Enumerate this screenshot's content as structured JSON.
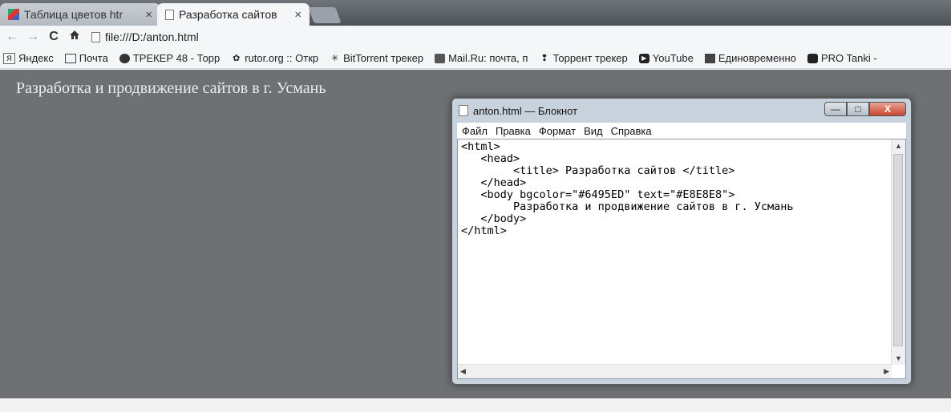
{
  "browser": {
    "tabs": [
      {
        "label": "Таблица цветов htr",
        "close": "×",
        "active": false
      },
      {
        "label": "Разработка сайтов",
        "close": "×",
        "active": true
      }
    ],
    "nav": {
      "back": "←",
      "forward": "→",
      "reload": "C",
      "home": "🏠"
    },
    "address": "file:///D:/anton.html",
    "bookmarks": [
      {
        "label": "Яндекс",
        "icon": "yandex-icon"
      },
      {
        "label": "Почта",
        "icon": "folder-icon"
      },
      {
        "label": "ТРЕКЕР 48 - Торр",
        "icon": "tracker-icon"
      },
      {
        "label": "rutor.org :: Откр",
        "icon": "rutor-icon"
      },
      {
        "label": "BitTorrent трекер",
        "icon": "bittorrent-icon"
      },
      {
        "label": "Mail.Ru: почта, п",
        "icon": "mailru-icon"
      },
      {
        "label": "Торрент трекер",
        "icon": "torrent-icon"
      },
      {
        "label": "YouTube",
        "icon": "youtube-icon"
      },
      {
        "label": "Единовременно",
        "icon": "photo-icon"
      },
      {
        "label": "PRO Tanki -",
        "icon": "protanki-icon"
      }
    ]
  },
  "page": {
    "heading": "Разработка и продвижение сайтов в г. Усмань",
    "background": "#6495ED",
    "text_color": "#E8E8E8"
  },
  "notepad": {
    "title": "anton.html — Блокнот",
    "controls": {
      "minimize": "—",
      "maximize": "□",
      "close": "X"
    },
    "menu": [
      "Файл",
      "Правка",
      "Формат",
      "Вид",
      "Справка"
    ],
    "content": "<html>\n   <head>\n        <title> Разработка сайтов </title>\n   </head>\n   <body bgcolor=\"#6495ED\" text=\"#E8E8E8\">\n        Разработка и продвижение сайтов в г. Усмань\n   </body>\n</html>"
  }
}
